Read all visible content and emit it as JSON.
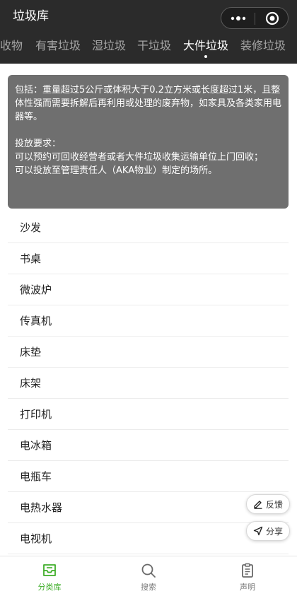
{
  "header": {
    "title": "垃圾库",
    "more_icon": "more-dots-icon",
    "close_icon": "target-circle-icon"
  },
  "tabs": [
    {
      "label": "收物",
      "active": false
    },
    {
      "label": "有害垃圾",
      "active": false
    },
    {
      "label": "湿垃圾",
      "active": false
    },
    {
      "label": "干垃圾",
      "active": false
    },
    {
      "label": "大件垃圾",
      "active": true
    },
    {
      "label": "装修垃圾",
      "active": false
    }
  ],
  "description": {
    "line1": "包括：重量超过5公斤或体积大于0.2立方米或长度超过1米，且整体性强而需要拆解后再利用或处理的废弃物，如家具及各类家用电器等。",
    "requirement_title": "投放要求：",
    "requirement_line1": "可以预约可回收经营者或者大件垃圾收集运输单位上门回收；",
    "requirement_line2": "可以投放至管理责任人（AKA物业）制定的场所。"
  },
  "items": [
    "沙发",
    "书桌",
    "微波炉",
    "传真机",
    "床垫",
    "床架",
    "打印机",
    "电冰箱",
    "电瓶车",
    "电热水器",
    "电视机"
  ],
  "float_buttons": {
    "feedback": "反馈",
    "share": "分享"
  },
  "tabbar": [
    {
      "label": "分类库",
      "icon": "inbox-tray-icon",
      "active": true
    },
    {
      "label": "搜索",
      "icon": "search-icon",
      "active": false
    },
    {
      "label": "声明",
      "icon": "clipboard-icon",
      "active": false
    }
  ],
  "colors": {
    "header_bg": "#2b2b2b",
    "card_bg": "#6f6f6f",
    "accent_green": "#3fae29"
  }
}
